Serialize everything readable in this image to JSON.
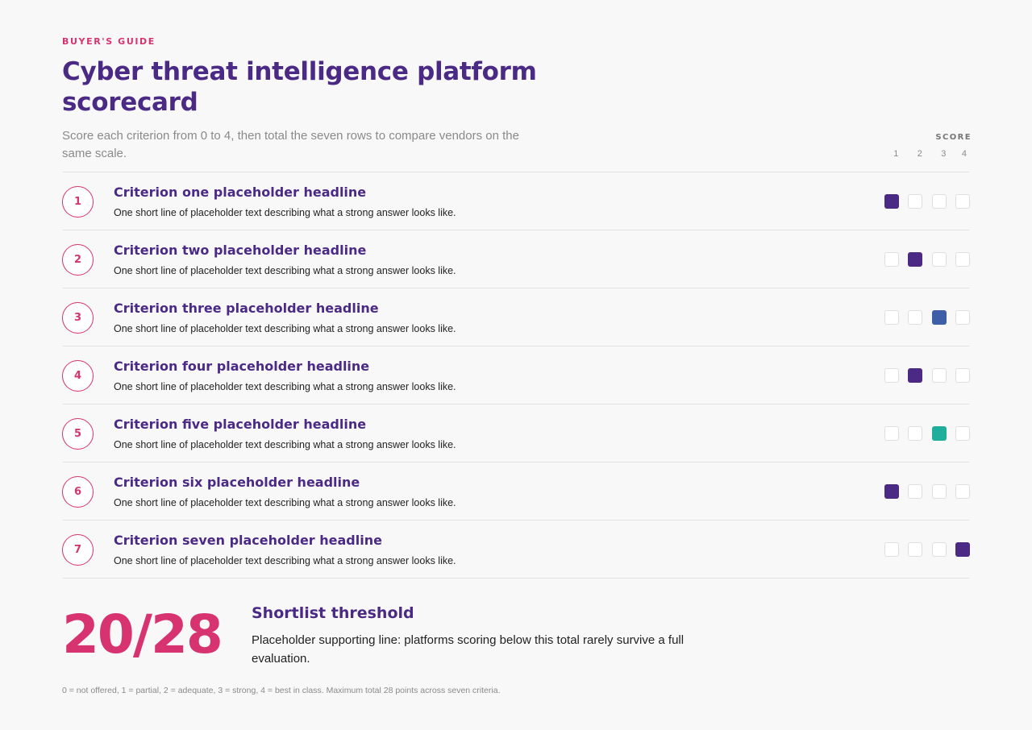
{
  "header": {
    "eyebrow": "BUYER'S GUIDE",
    "title": "Cyber threat intelligence platform scorecard",
    "intro": "Score each criterion from 0 to 4, then total the seven rows to compare vendors on the same scale."
  },
  "score_header": {
    "label": "SCORE",
    "levels": [
      "1",
      "2",
      "3",
      "4"
    ]
  },
  "colors": {
    "accent_pink": "#d63370",
    "purple": "#4b2a85",
    "blue": "#3e5ea8",
    "teal": "#1fae9b"
  },
  "criteria": [
    {
      "number": "1",
      "title": "Criterion one placeholder headline",
      "description": "One short line of placeholder text describing what a strong answer looks like.",
      "score": 1,
      "color": "#4b2a85"
    },
    {
      "number": "2",
      "title": "Criterion two placeholder headline",
      "description": "One short line of placeholder text describing what a strong answer looks like.",
      "score": 2,
      "color": "#4b2a85"
    },
    {
      "number": "3",
      "title": "Criterion three placeholder headline",
      "description": "One short line of placeholder text describing what a strong answer looks like.",
      "score": 3,
      "color": "#3e5ea8"
    },
    {
      "number": "4",
      "title": "Criterion four placeholder headline",
      "description": "One short line of placeholder text describing what a strong answer looks like.",
      "score": 2,
      "color": "#4b2a85"
    },
    {
      "number": "5",
      "title": "Criterion five placeholder headline",
      "description": "One short line of placeholder text describing what a strong answer looks like.",
      "score": 3,
      "color": "#1fae9b"
    },
    {
      "number": "6",
      "title": "Criterion six placeholder headline",
      "description": "One short line of placeholder text describing what a strong answer looks like.",
      "score": 1,
      "color": "#4b2a85"
    },
    {
      "number": "7",
      "title": "Criterion seven placeholder headline",
      "description": "One short line of placeholder text describing what a strong answer looks like.",
      "score": 4,
      "color": "#4b2a85"
    }
  ],
  "summary": {
    "total": "20/28",
    "threshold_title": "Shortlist threshold",
    "threshold_text": "Placeholder supporting line: platforms scoring below this total rarely survive a full evaluation."
  },
  "footnote": "0 = not offered, 1 = partial, 2 = adequate, 3 = strong, 4 = best in class. Maximum total 28 points across seven criteria."
}
